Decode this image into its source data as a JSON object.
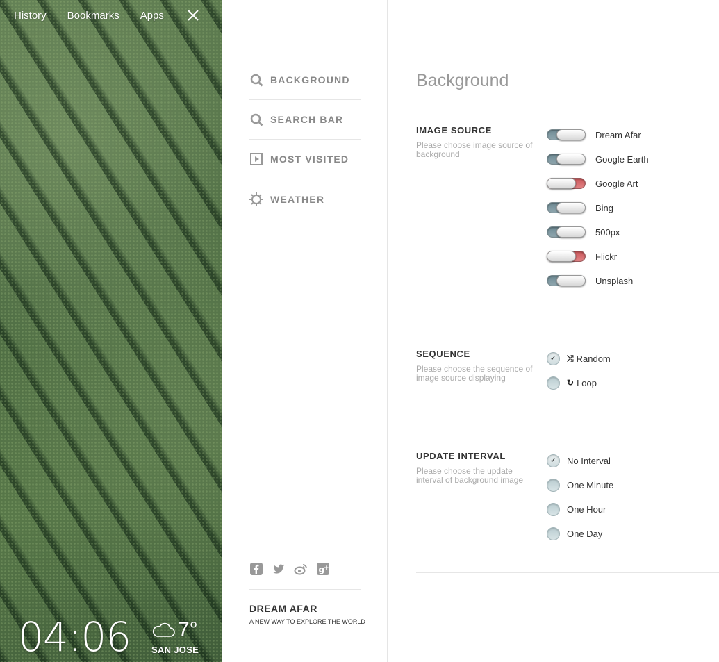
{
  "nav": {
    "history": "History",
    "bookmarks": "Bookmarks",
    "apps": "Apps"
  },
  "clock": {
    "time": "04:06"
  },
  "weather": {
    "temp": "7°",
    "city": "SAN JOSE"
  },
  "menu": {
    "items": [
      {
        "label": "BACKGROUND",
        "icon": "search-icon"
      },
      {
        "label": "SEARCH BAR",
        "icon": "search-icon"
      },
      {
        "label": "MOST VISITED",
        "icon": "play-square-icon"
      },
      {
        "label": "WEATHER",
        "icon": "sun-icon"
      }
    ],
    "social": [
      "facebook-icon",
      "twitter-icon",
      "weibo-icon",
      "google-plus-icon"
    ]
  },
  "brand": {
    "name": "DREAM AFAR",
    "tagline": "A NEW WAY TO EXPLORE THE WORLD"
  },
  "settings": {
    "title": "Background",
    "image_source": {
      "title": "IMAGE SOURCE",
      "desc": "Please choose image source of background",
      "options": [
        {
          "label": "Dream Afar",
          "enabled": true
        },
        {
          "label": "Google Earth",
          "enabled": true
        },
        {
          "label": "Google Art",
          "enabled": false
        },
        {
          "label": "Bing",
          "enabled": true
        },
        {
          "label": "500px",
          "enabled": true
        },
        {
          "label": "Flickr",
          "enabled": false
        },
        {
          "label": "Unsplash",
          "enabled": true
        }
      ]
    },
    "sequence": {
      "title": "SEQUENCE",
      "desc": "Please choose the sequence of image source displaying",
      "options": [
        {
          "label": "Random",
          "icon": "shuffle-icon",
          "checked": true
        },
        {
          "label": "Loop",
          "icon": "loop-icon",
          "checked": false
        }
      ]
    },
    "update_interval": {
      "title": "UPDATE INTERVAL",
      "desc": "Please choose the update interval of background image",
      "options": [
        {
          "label": "No Interval",
          "checked": true
        },
        {
          "label": "One Minute",
          "checked": false
        },
        {
          "label": "One Hour",
          "checked": false
        },
        {
          "label": "One Day",
          "checked": false
        }
      ]
    }
  },
  "colors": {
    "toggle_on": "#7f98a0",
    "toggle_off": "#d86c6e",
    "accent_text": "#999999"
  }
}
